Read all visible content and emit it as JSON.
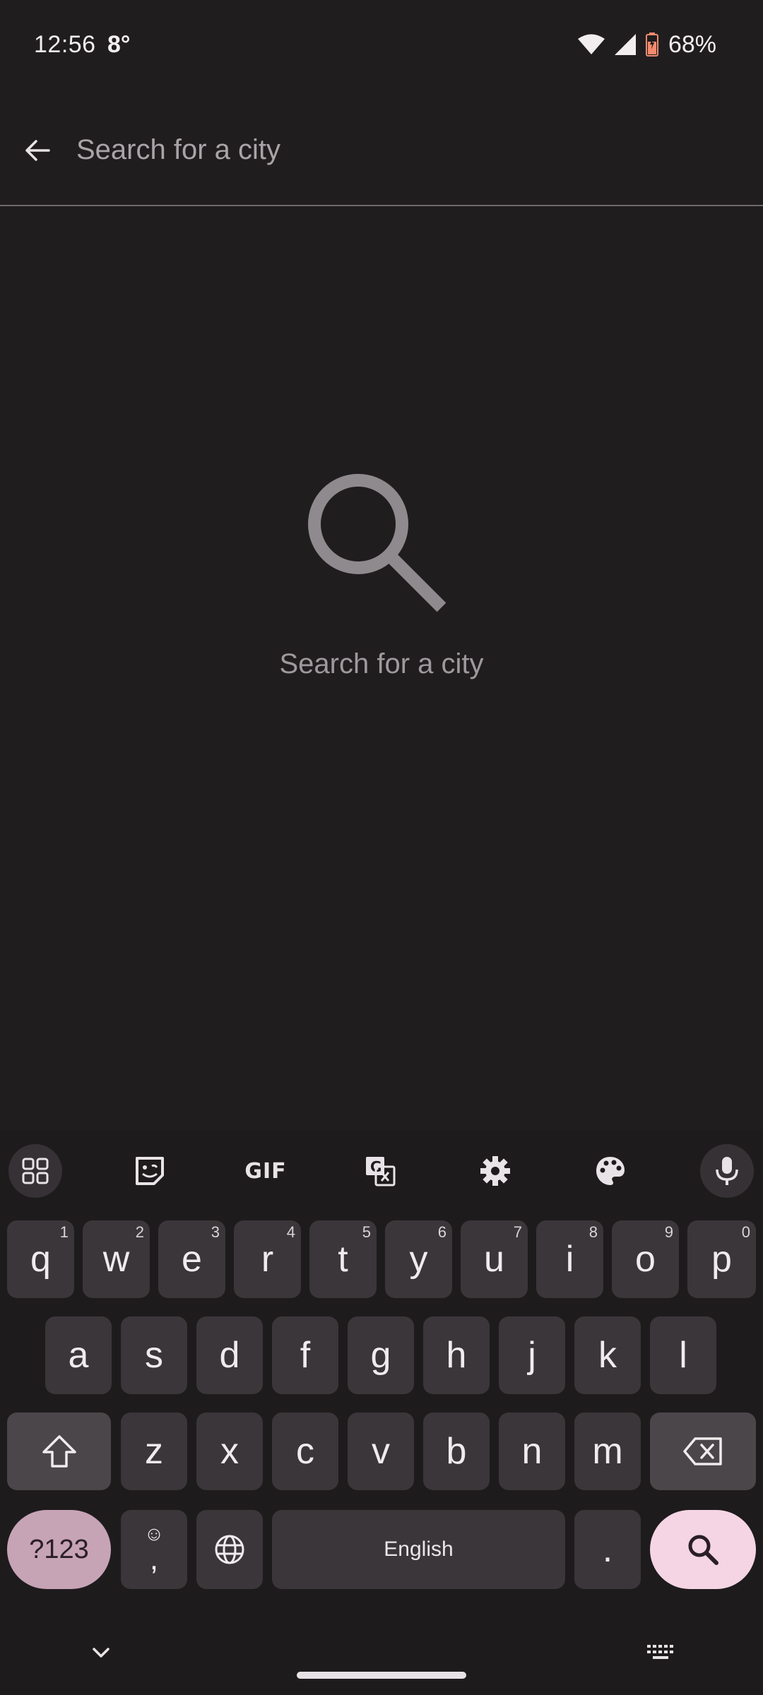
{
  "status_bar": {
    "time": "12:56",
    "temperature": "8°",
    "battery": "68%",
    "icons": [
      "wifi-icon",
      "cell-signal-icon",
      "battery-icon"
    ]
  },
  "search": {
    "placeholder": "Search for a city",
    "value": "",
    "back_icon": "arrow-back-icon"
  },
  "empty_state": {
    "icon": "search-icon",
    "text": "Search for a city"
  },
  "keyboard": {
    "toolbar": [
      {
        "name": "apps-grid-icon"
      },
      {
        "name": "sticker-icon"
      },
      {
        "name": "gif-button",
        "label": "GIF"
      },
      {
        "name": "translate-icon"
      },
      {
        "name": "settings-gear-icon"
      },
      {
        "name": "palette-icon"
      },
      {
        "name": "microphone-icon"
      }
    ],
    "row1": [
      {
        "key": "q",
        "hint": "1"
      },
      {
        "key": "w",
        "hint": "2"
      },
      {
        "key": "e",
        "hint": "3"
      },
      {
        "key": "r",
        "hint": "4"
      },
      {
        "key": "t",
        "hint": "5"
      },
      {
        "key": "y",
        "hint": "6"
      },
      {
        "key": "u",
        "hint": "7"
      },
      {
        "key": "i",
        "hint": "8"
      },
      {
        "key": "o",
        "hint": "9"
      },
      {
        "key": "p",
        "hint": "0"
      }
    ],
    "row2": [
      "a",
      "s",
      "d",
      "f",
      "g",
      "h",
      "j",
      "k",
      "l"
    ],
    "row3": [
      "z",
      "x",
      "c",
      "v",
      "b",
      "n",
      "m"
    ],
    "symbols_label": "?123",
    "comma_label": ",",
    "space_label": "English",
    "period_label": ".",
    "colors": {
      "key": "#3a3639",
      "symbols_key": "#c7a3b6",
      "enter_key": "#f5d5e3"
    }
  }
}
